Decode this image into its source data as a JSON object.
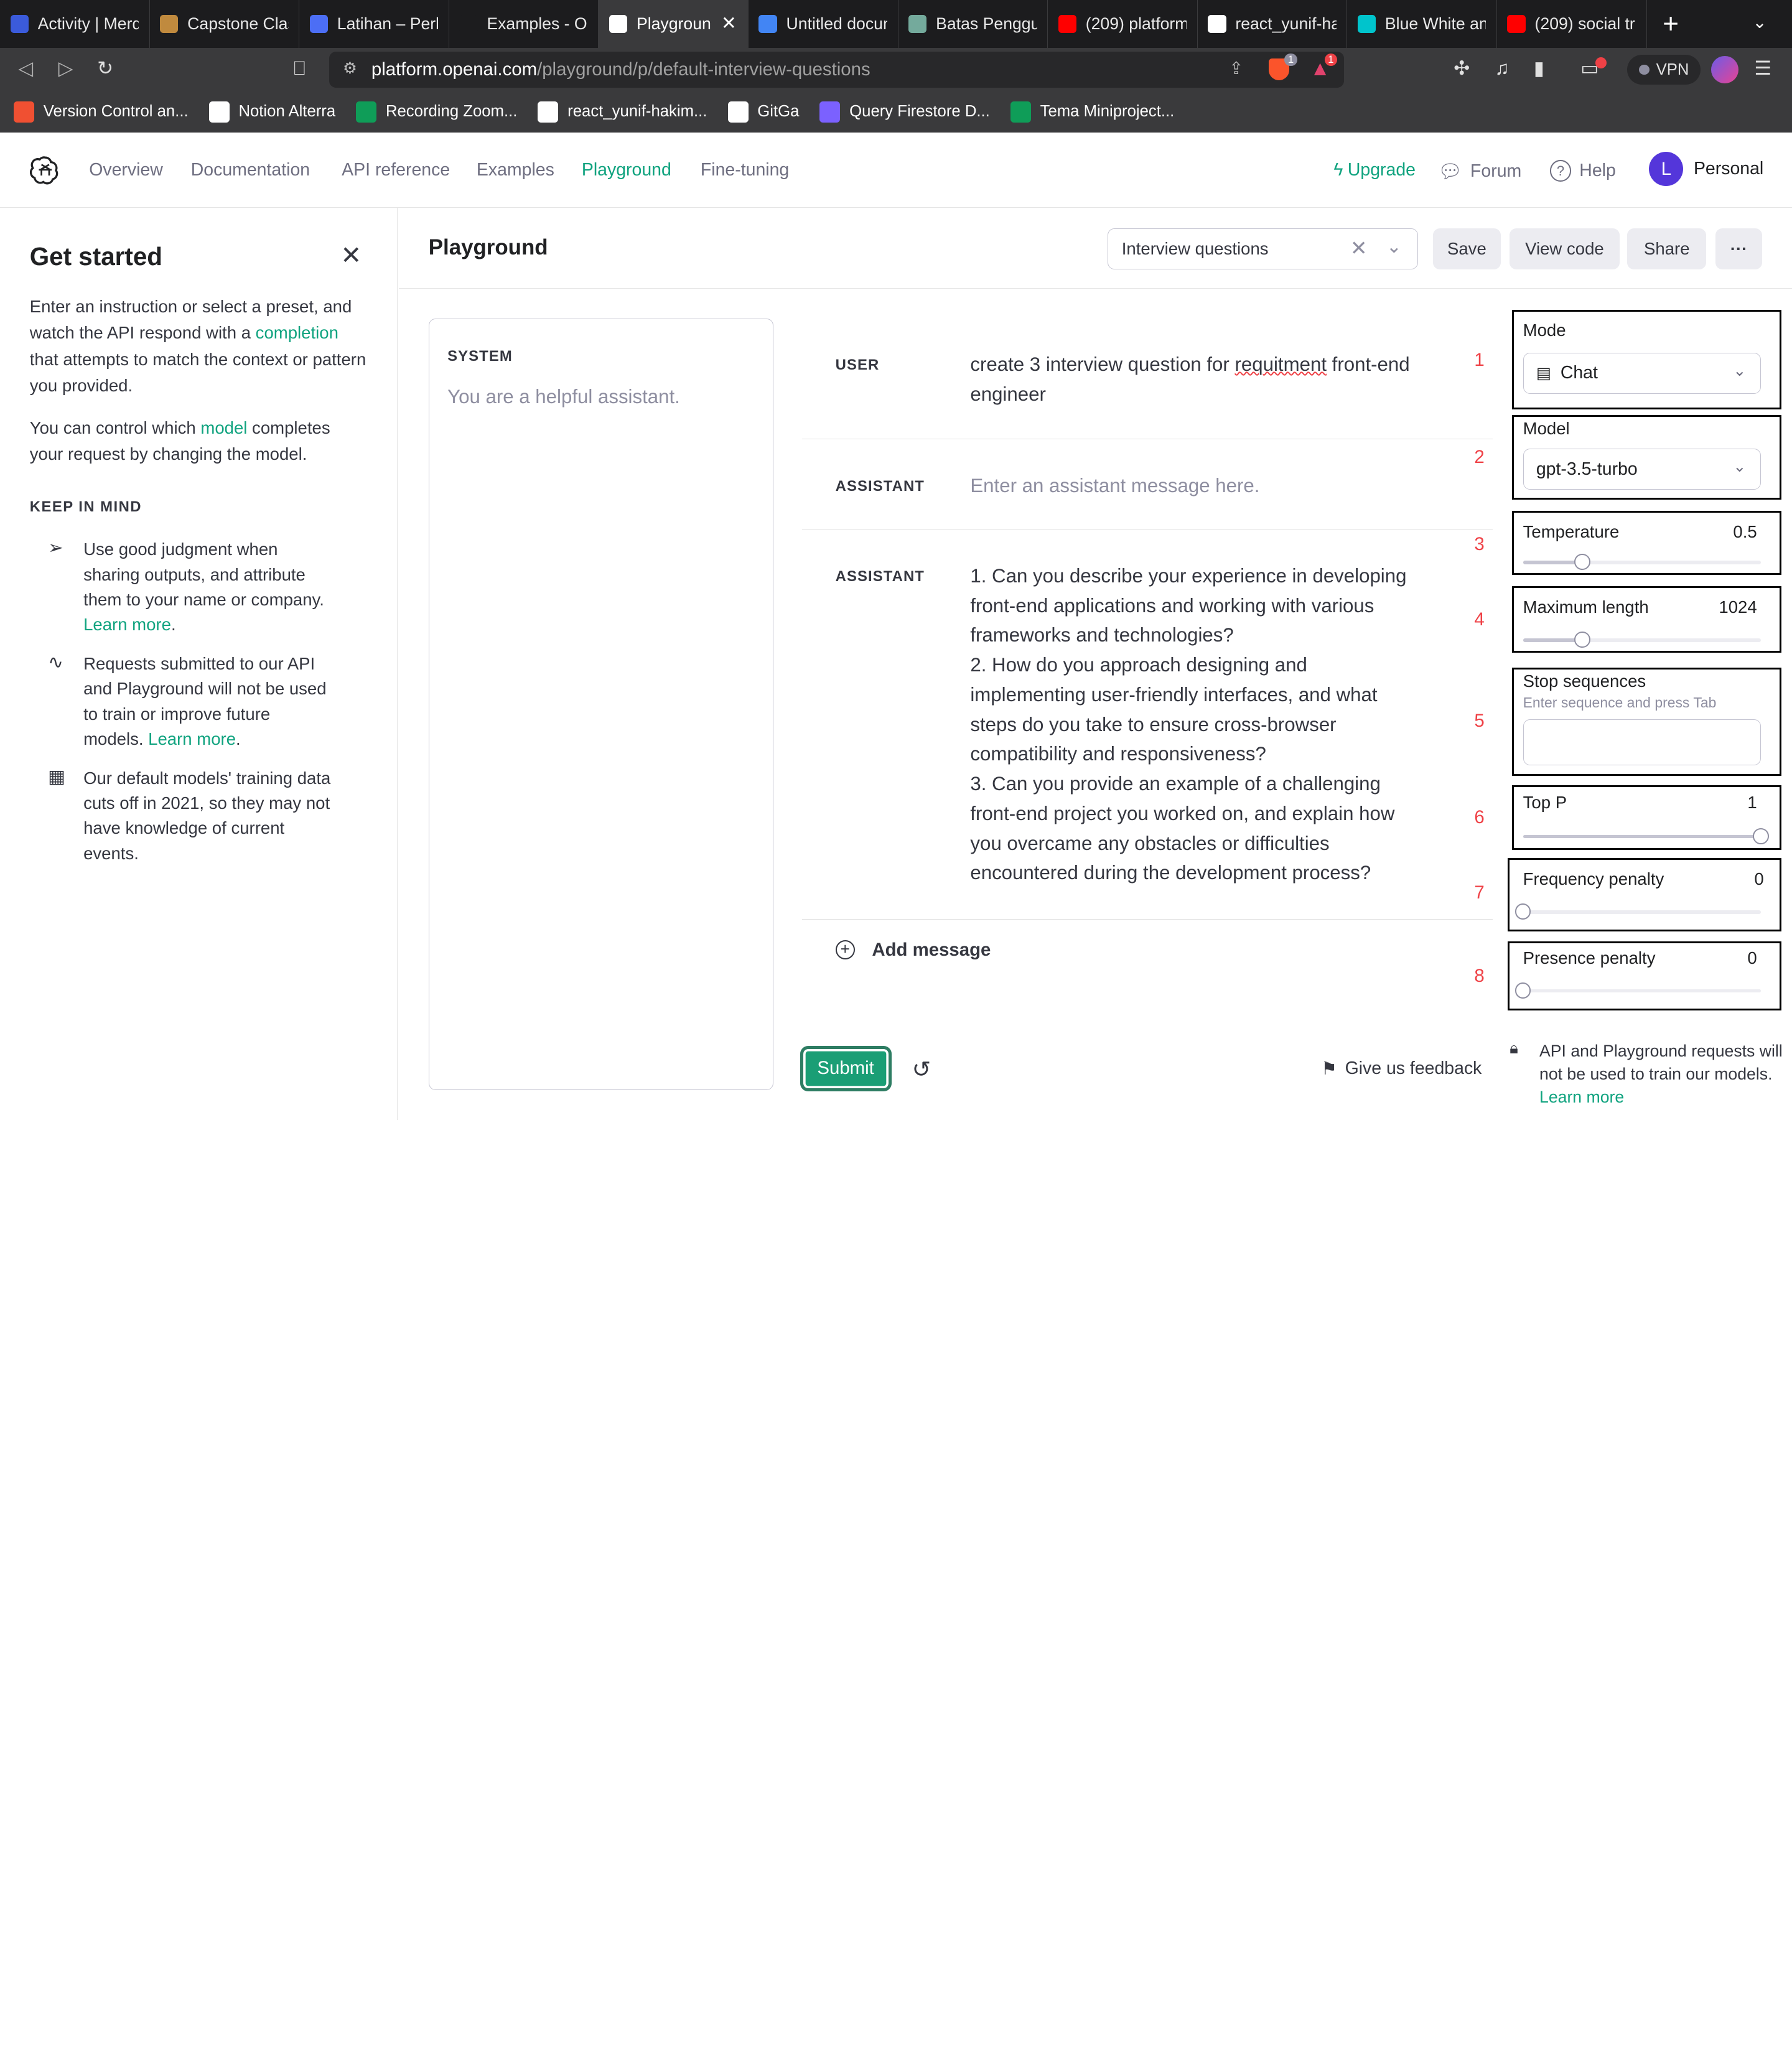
{
  "browser": {
    "tabs": [
      {
        "title": "Activity | Merd",
        "color": "#3b5bdb"
      },
      {
        "title": "Capstone Clas",
        "color": "#c08a3e"
      },
      {
        "title": "Latihan – Perk",
        "color": "#4c6ef5"
      },
      {
        "title": "Examples - Op",
        "color": "#1c1c1e"
      },
      {
        "title": "Playgroun",
        "color": "#ffffff",
        "active": true
      },
      {
        "title": "Untitled docun",
        "color": "#4285f4"
      },
      {
        "title": "Batas Penggun",
        "color": "#74aa9c"
      },
      {
        "title": "(209) platform",
        "color": "#ff0000"
      },
      {
        "title": "react_yunif-ha",
        "color": "#ffffff"
      },
      {
        "title": "Blue White and",
        "color": "#00c4cc"
      },
      {
        "title": "(209) social tr",
        "color": "#ff0000"
      }
    ],
    "new_tab_label": "+",
    "url_domain": "platform.openai.com",
    "url_path": "/playground/p/default-interview-questions",
    "brave_badge": "1",
    "alert_badge": "1",
    "vpn_label": "VPN",
    "bookmarks": [
      {
        "label": "Version Control an...",
        "color": "#f05032"
      },
      {
        "label": "Notion Alterra",
        "color": "#ffffff"
      },
      {
        "label": "Recording Zoom...",
        "color": "#0f9d58"
      },
      {
        "label": "react_yunif-hakim...",
        "color": "#ffffff"
      },
      {
        "label": "GitGa",
        "color": "#ffffff"
      },
      {
        "label": "Query Firestore D...",
        "color": "#7b61ff"
      },
      {
        "label": "Tema Miniproject...",
        "color": "#0f9d58"
      }
    ]
  },
  "nav": {
    "links": [
      "Overview",
      "Documentation",
      "API reference",
      "Examples",
      "Playground",
      "Fine-tuning"
    ],
    "active": "Playground",
    "upgrade": "Upgrade",
    "forum": "Forum",
    "help": "Help",
    "avatar_initial": "L",
    "account": "Personal"
  },
  "sidebar": {
    "title": "Get started",
    "intro_pre": "Enter an instruction or select a preset, and watch the API respond with a ",
    "intro_link": "completion",
    "intro_post": " that attempts to match the context or pattern you provided.",
    "model_pre": "You can control which ",
    "model_link": "model",
    "model_post": " completes your request by changing the model.",
    "keep_in_mind": "KEEP IN MIND",
    "items": [
      {
        "icon": "send-icon",
        "text": "Use good judgment when sharing outputs, and attribute them to your name or company. ",
        "link": "Learn more",
        "after": "."
      },
      {
        "icon": "activity-icon",
        "text": "Requests submitted to our API and Playground will not be used to train or improve future models. ",
        "link": "Learn more",
        "after": "."
      },
      {
        "icon": "calendar-icon",
        "text": "Our default models' training data cuts off in 2021, so they may not have knowledge of current events.",
        "link": "",
        "after": ""
      }
    ]
  },
  "header": {
    "title": "Playground",
    "preset": "Interview questions",
    "save": "Save",
    "view_code": "View code",
    "share": "Share",
    "more": "···"
  },
  "system": {
    "label": "SYSTEM",
    "placeholder": "You are a helpful assistant."
  },
  "messages": [
    {
      "role": "USER",
      "text": "create 3 interview question for requitment front-end engineer",
      "placeholder": false
    },
    {
      "role": "ASSISTANT",
      "text": "Enter an assistant message here.",
      "placeholder": true
    },
    {
      "role": "ASSISTANT",
      "text": "1. Can you describe your experience in developing front-end applications and working with various frameworks and technologies?\n2. How do you approach designing and implementing user-friendly interfaces, and what steps do you take to ensure cross-browser compatibility and responsiveness?\n3. Can you provide an example of a challenging front-end project you worked on, and explain how you overcame any obstacles or difficulties encountered during the development process?",
      "placeholder": false
    }
  ],
  "add_message": "Add message",
  "submit": "Submit",
  "feedback": "Give us feedback",
  "annotations": [
    "1",
    "2",
    "3",
    "4",
    "5",
    "6",
    "7",
    "8"
  ],
  "settings": {
    "mode_label": "Mode",
    "mode_value": "Chat",
    "model_label": "Model",
    "model_value": "gpt-3.5-turbo",
    "temperature_label": "Temperature",
    "temperature_value": "0.5",
    "temperature_fraction": 0.25,
    "max_length_label": "Maximum length",
    "max_length_value": "1024",
    "max_length_fraction": 0.25,
    "stop_label": "Stop sequences",
    "stop_hint": "Enter sequence and press Tab",
    "top_p_label": "Top P",
    "top_p_value": "1",
    "top_p_fraction": 1,
    "freq_label": "Frequency penalty",
    "freq_value": "0",
    "freq_fraction": 0,
    "presence_label": "Presence penalty",
    "presence_value": "0",
    "presence_fraction": 0
  },
  "privacy": {
    "text": "API and Playground requests will not be used to train our models. ",
    "link": "Learn more"
  }
}
